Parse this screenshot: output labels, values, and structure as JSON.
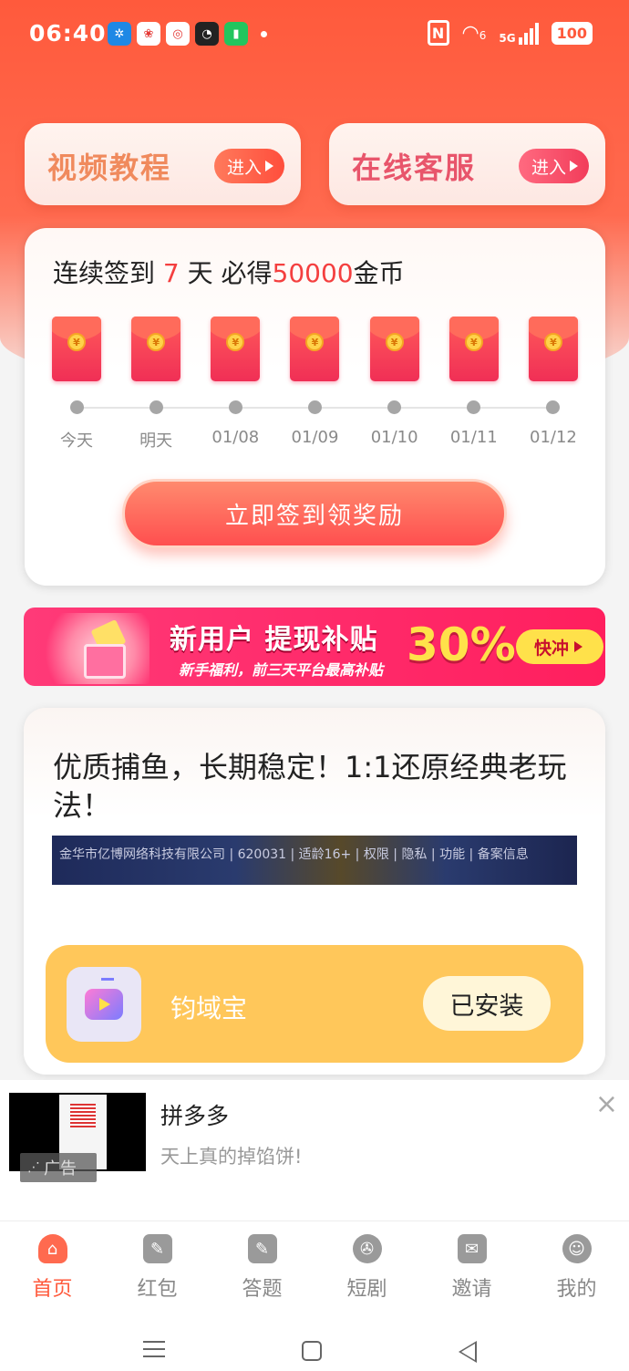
{
  "status_bar": {
    "time": "06:40",
    "notification_icons": [
      "pinwheel-app-icon",
      "lucky-app-icon",
      "weibo-icon",
      "qq-icon",
      "battery-saver-icon"
    ],
    "network": "5G",
    "wifi_label": "6",
    "battery": "100"
  },
  "top_cards": [
    {
      "title": "视频教程",
      "button": "进入"
    },
    {
      "title": "在线客服",
      "button": "进入"
    }
  ],
  "checkin": {
    "title_prefix": "连续签到 ",
    "days": "7",
    "title_middle": " 天 必得",
    "coins": "50000",
    "title_suffix": "金币",
    "day_labels": [
      "今天",
      "明天",
      "01/08",
      "01/09",
      "01/10",
      "01/11",
      "01/12"
    ],
    "button": "立即签到领奖励"
  },
  "banner": {
    "main": "新用户 提现补贴",
    "sub": "新手福利，前三天平台最高补贴",
    "percent": "30%",
    "button": "快冲"
  },
  "game_card": {
    "title": "优质捕鱼，长期稳定！1:1还原经典老玩法！",
    "strip_text": "金华市亿博网络科技有限公司 | 620031 | 适龄16+ | 权限 | 隐私 | 功能 | 备案信息",
    "app_name": "钧域宝",
    "install_status": "已安装"
  },
  "ad": {
    "tag": "广告",
    "title": "拼多多",
    "desc": "天上真的掉馅饼!",
    "close": "×"
  },
  "bottom_nav": [
    {
      "label": "首页",
      "icon": "home-icon",
      "active": true
    },
    {
      "label": "红包",
      "icon": "red-packet-icon",
      "active": false
    },
    {
      "label": "答题",
      "icon": "quiz-icon",
      "active": false
    },
    {
      "label": "短剧",
      "icon": "film-reel-icon",
      "active": false
    },
    {
      "label": "邀请",
      "icon": "invite-icon",
      "active": false
    },
    {
      "label": "我的",
      "icon": "profile-icon",
      "active": false
    }
  ],
  "colors": {
    "accent": "#ff5a3c",
    "highlight": "#f43f3f",
    "install_bar": "#ffc75a",
    "banner": "#ff2a6a"
  }
}
